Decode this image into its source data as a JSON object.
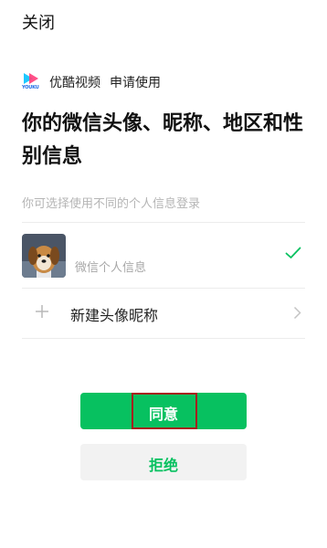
{
  "header": {
    "close_label": "关闭"
  },
  "app": {
    "logo_text": "YOUKU",
    "name": "优酷视频",
    "request": "申请使用"
  },
  "title": "你的微信头像、昵称、地区和性别信息",
  "subtitle": "你可选择使用不同的个人信息登录",
  "options": {
    "wechat_label": "微信个人信息",
    "new_label": "新建头像昵称"
  },
  "buttons": {
    "agree": "同意",
    "reject": "拒绝"
  },
  "colors": {
    "accent": "#07c160",
    "highlight_border": "#a61e1e"
  }
}
